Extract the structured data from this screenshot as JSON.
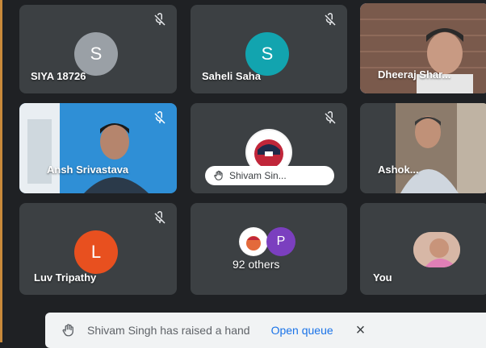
{
  "participants": [
    {
      "name": "SIYA 18726",
      "initial": "S",
      "avatar_color": "#9aa0a6",
      "muted": true
    },
    {
      "name": "Saheli Saha",
      "initial": "S",
      "avatar_color": "#12a4af",
      "muted": true
    },
    {
      "name": "Dheeraj Shar...",
      "muted": false,
      "video": true
    },
    {
      "name": "Ansh Srivastava",
      "muted": true,
      "video": true
    },
    {
      "name": "Shivam Sin...",
      "muted": true,
      "hand_raised": true
    },
    {
      "name": "Ashok...",
      "muted": false,
      "video": true
    },
    {
      "name": "Luv Tripathy",
      "initial": "L",
      "avatar_color": "#e8501f",
      "muted": true
    },
    {
      "name": "92 others",
      "avatar_p": "P",
      "avatar_p_color": "#7b3fbf",
      "muted": false
    },
    {
      "name": "You",
      "muted": false
    }
  ],
  "notification": {
    "message": "Shivam Singh has raised a hand",
    "action": "Open queue",
    "close": "×"
  },
  "colors": {
    "background": "#1f2124",
    "tile": "#3c4043",
    "accent": "#8ab4f8",
    "link": "#1a73e8"
  }
}
